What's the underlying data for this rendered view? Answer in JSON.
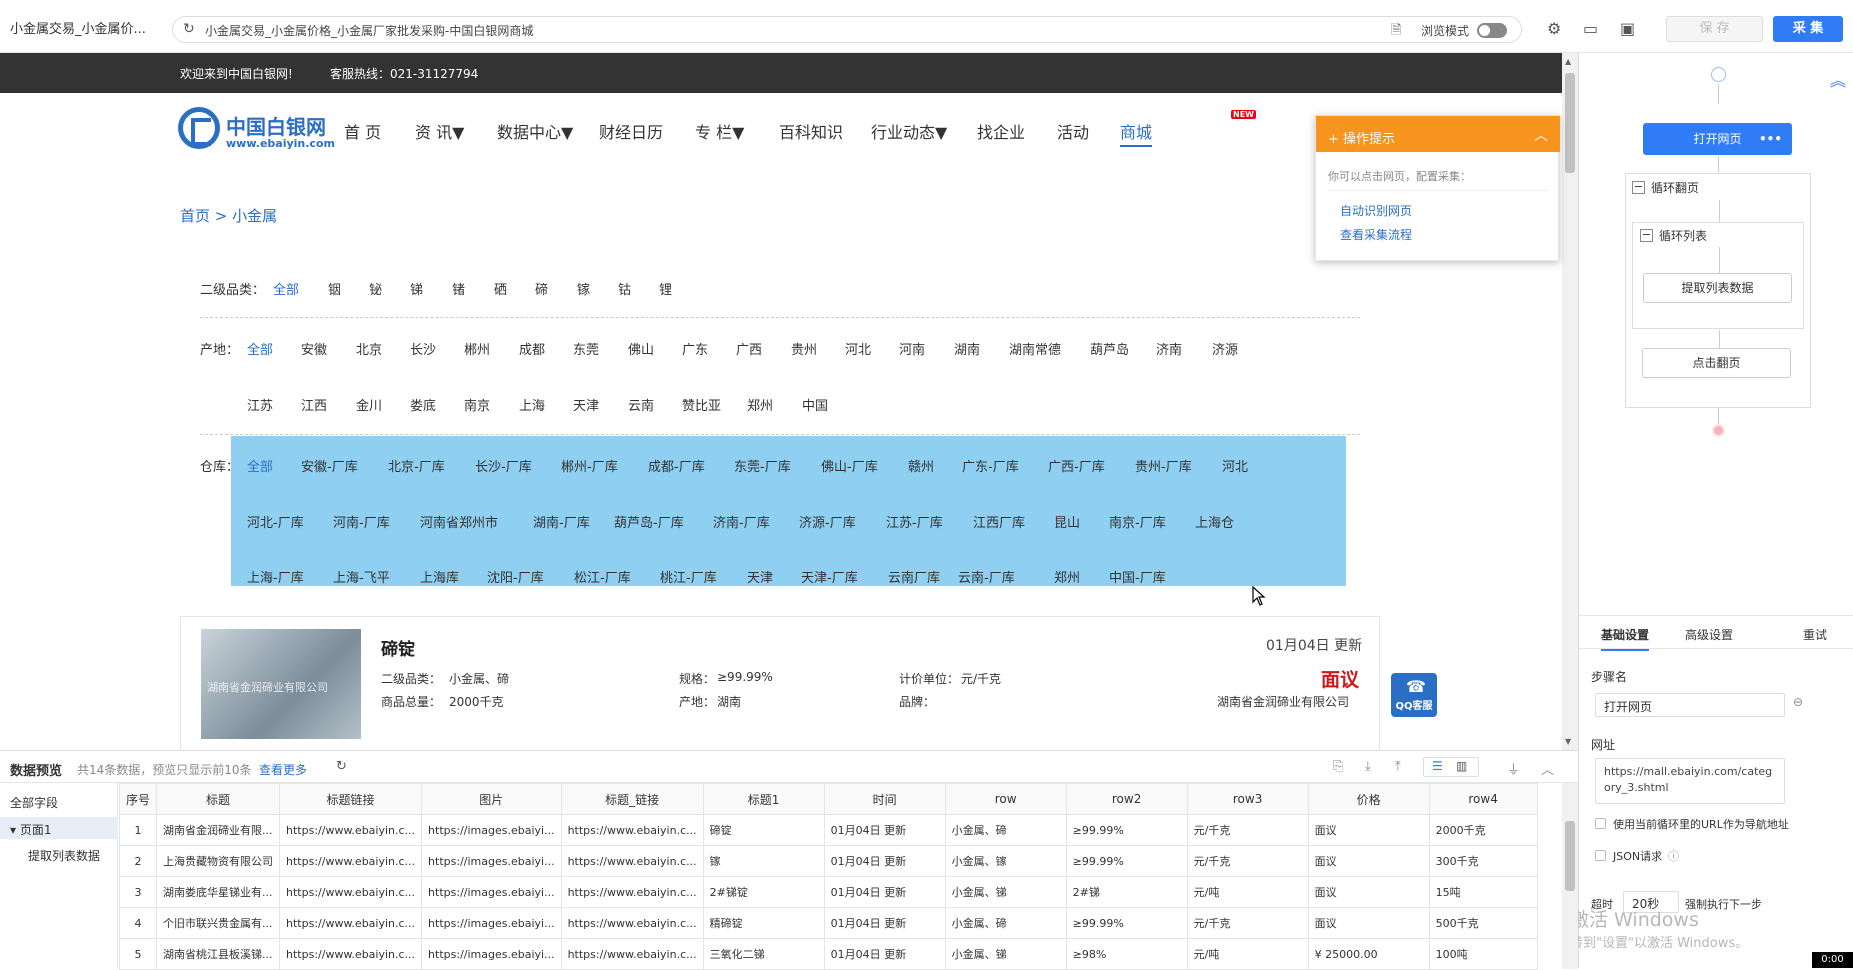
{
  "toolbar": {
    "tab_title": "小金属交易_小金属价...",
    "reload_icon": "reload-icon",
    "url_title": "小金属交易_小金属价格_小金属厂家批发采购-中国白银网商城",
    "browse_mode": "浏览模式",
    "save": "保 存",
    "collect": "采 集"
  },
  "site": {
    "welcome": "欢迎来到中国白银网!",
    "hotline": "客服热线：021-31127794",
    "logo_name": "中国白银网",
    "logo_url": "www.ebaiyin.com",
    "nav": [
      "首 页",
      "资 讯▼",
      "数据中心▼",
      "财经日历",
      "专 栏▼",
      "百科知识",
      "行业动态▼",
      "找企业",
      "活动",
      "商城"
    ],
    "new_badge": "NEW",
    "breadcrumb": "首页 > 小金属"
  },
  "filters": {
    "category_label": "二级品类：",
    "categories": [
      "全部",
      "铟",
      "铋",
      "锑",
      "锗",
      "硒",
      "碲",
      "镓",
      "钴",
      "锂"
    ],
    "origin_label": "产地：",
    "origins_row1": [
      "全部",
      "安徽",
      "北京",
      "长沙",
      "郴州",
      "成都",
      "东莞",
      "佛山",
      "广东",
      "广西",
      "贵州",
      "河北",
      "河南",
      "湖南",
      "湖南常德",
      "葫芦岛",
      "济南",
      "济源"
    ],
    "origins_row2": [
      "江苏",
      "江西",
      "金川",
      "娄底",
      "南京",
      "上海",
      "天津",
      "云南",
      "赞比亚",
      "郑州",
      "中国"
    ],
    "warehouse_label": "仓库：",
    "warehouses_row1": [
      "全部",
      "安徽-厂库",
      "北京-厂库",
      "长沙-厂库",
      "郴州-厂库",
      "成都-厂库",
      "东莞-厂库",
      "佛山-厂库",
      "赣州",
      "广东-厂库",
      "广西-厂库",
      "贵州-厂库",
      "河北"
    ],
    "warehouses_row2": [
      "河北-厂库",
      "河南-厂库",
      "河南省郑州市",
      "湖南-厂库",
      "葫芦岛-厂库",
      "济南-厂库",
      "济源-厂库",
      "江苏-厂库",
      "江西厂库",
      "昆山",
      "南京-厂库",
      "上海仓"
    ],
    "warehouses_row3": [
      "上海-厂库",
      "上海-飞平",
      "上海库",
      "沈阳-厂库",
      "松江-厂库",
      "桃江-厂库",
      "天津",
      "天津-厂库",
      "云南厂库",
      "云南-厂库",
      "郑州",
      "中国-厂库"
    ]
  },
  "product": {
    "title": "碲锭",
    "date": "01月04日 更新",
    "price": "面议",
    "img_text": "湖南省金润碲业有限公司",
    "cat_key": "二级品类：",
    "cat_val": "小金属、碲",
    "spec_key": "规格：",
    "spec_val": "≥99.99%",
    "unit_key": "计价单位：",
    "unit_val": "元/千克",
    "total_key": "商品总量：",
    "total_val": "2000千克",
    "origin_key": "产地：",
    "origin_val": "湖南",
    "brand_key": "品牌：",
    "company": "湖南省金润碲业有限公司",
    "qq": "QQ客服"
  },
  "tip": {
    "title": "操作提示",
    "text": "你可以点击网页，配置采集：",
    "link1": "自动识别网页",
    "link2": "查看采集流程"
  },
  "flow": {
    "open_page": "打开网页",
    "dots": "•••",
    "loop_page": "循环翻页",
    "loop_list": "循环列表",
    "extract": "提取列表数据",
    "click_page": "点击翻页",
    "minus": "−"
  },
  "settings": {
    "tabs": [
      "基础设置",
      "高级设置",
      "重试"
    ],
    "step_name_label": "步骤名",
    "step_name": "打开网页",
    "url_label": "网址",
    "url": "https://mall.ebaiyin.com/category_3.shtml",
    "use_loop_url": "使用当前循环里的URL作为导航地址",
    "json_request": "JSON请求",
    "timeout_label": "超时",
    "timeout_value": "20秒",
    "force_next": "强制执行下一步"
  },
  "watermark": {
    "line1": "激活 Windows",
    "line2": "转到\"设置\"以激活 Windows。"
  },
  "clock": "0:00",
  "preview": {
    "title": "数据预览",
    "info": "共14条数据，预览只显示前10条",
    "more": "查看更多",
    "all_fields": "全部字段",
    "page1": "页面1",
    "extract": "提取列表数据",
    "columns": [
      "序号",
      "标题",
      "标题链接",
      "图片",
      "标题_链接",
      "标题1",
      "时间",
      "row",
      "row2",
      "row3",
      "价格",
      "row4"
    ],
    "rows": [
      [
        "1",
        "湖南省金润碲业有限...",
        "https://www.ebaiyin.c...",
        "https://images.ebaiyi...",
        "https://www.ebaiyin.c...",
        "碲锭",
        "01月04日 更新",
        "小金属、碲",
        "≥99.99%",
        "元/千克",
        "面议",
        "2000千克"
      ],
      [
        "2",
        "上海贵藏物资有限公司",
        "https://www.ebaiyin.c...",
        "https://images.ebaiyi...",
        "https://www.ebaiyin.c...",
        "镓",
        "01月04日 更新",
        "小金属、镓",
        "≥99.99%",
        "元/千克",
        "面议",
        "300千克"
      ],
      [
        "3",
        "湖南娄底华星锑业有...",
        "https://www.ebaiyin.c...",
        "https://images.ebaiyi...",
        "https://www.ebaiyin.c...",
        "2#锑锭",
        "01月04日 更新",
        "小金属、锑",
        "2#锑",
        "元/吨",
        "面议",
        "15吨"
      ],
      [
        "4",
        "个旧市联兴贵金属有...",
        "https://www.ebaiyin.c...",
        "https://images.ebaiyi...",
        "https://www.ebaiyin.c...",
        "精碲锭",
        "01月04日 更新",
        "小金属、碲",
        "≥99.99%",
        "元/千克",
        "面议",
        "500千克"
      ],
      [
        "5",
        "湖南省桃江县板溪锑...",
        "https://www.ebaiyin.c...",
        "https://images.ebaiyi...",
        "https://www.ebaiyin.c...",
        "三氧化二锑",
        "01月04日 更新",
        "小金属、锑",
        "≥98%",
        "元/吨",
        "¥ 25000.00",
        "100吨"
      ]
    ]
  }
}
